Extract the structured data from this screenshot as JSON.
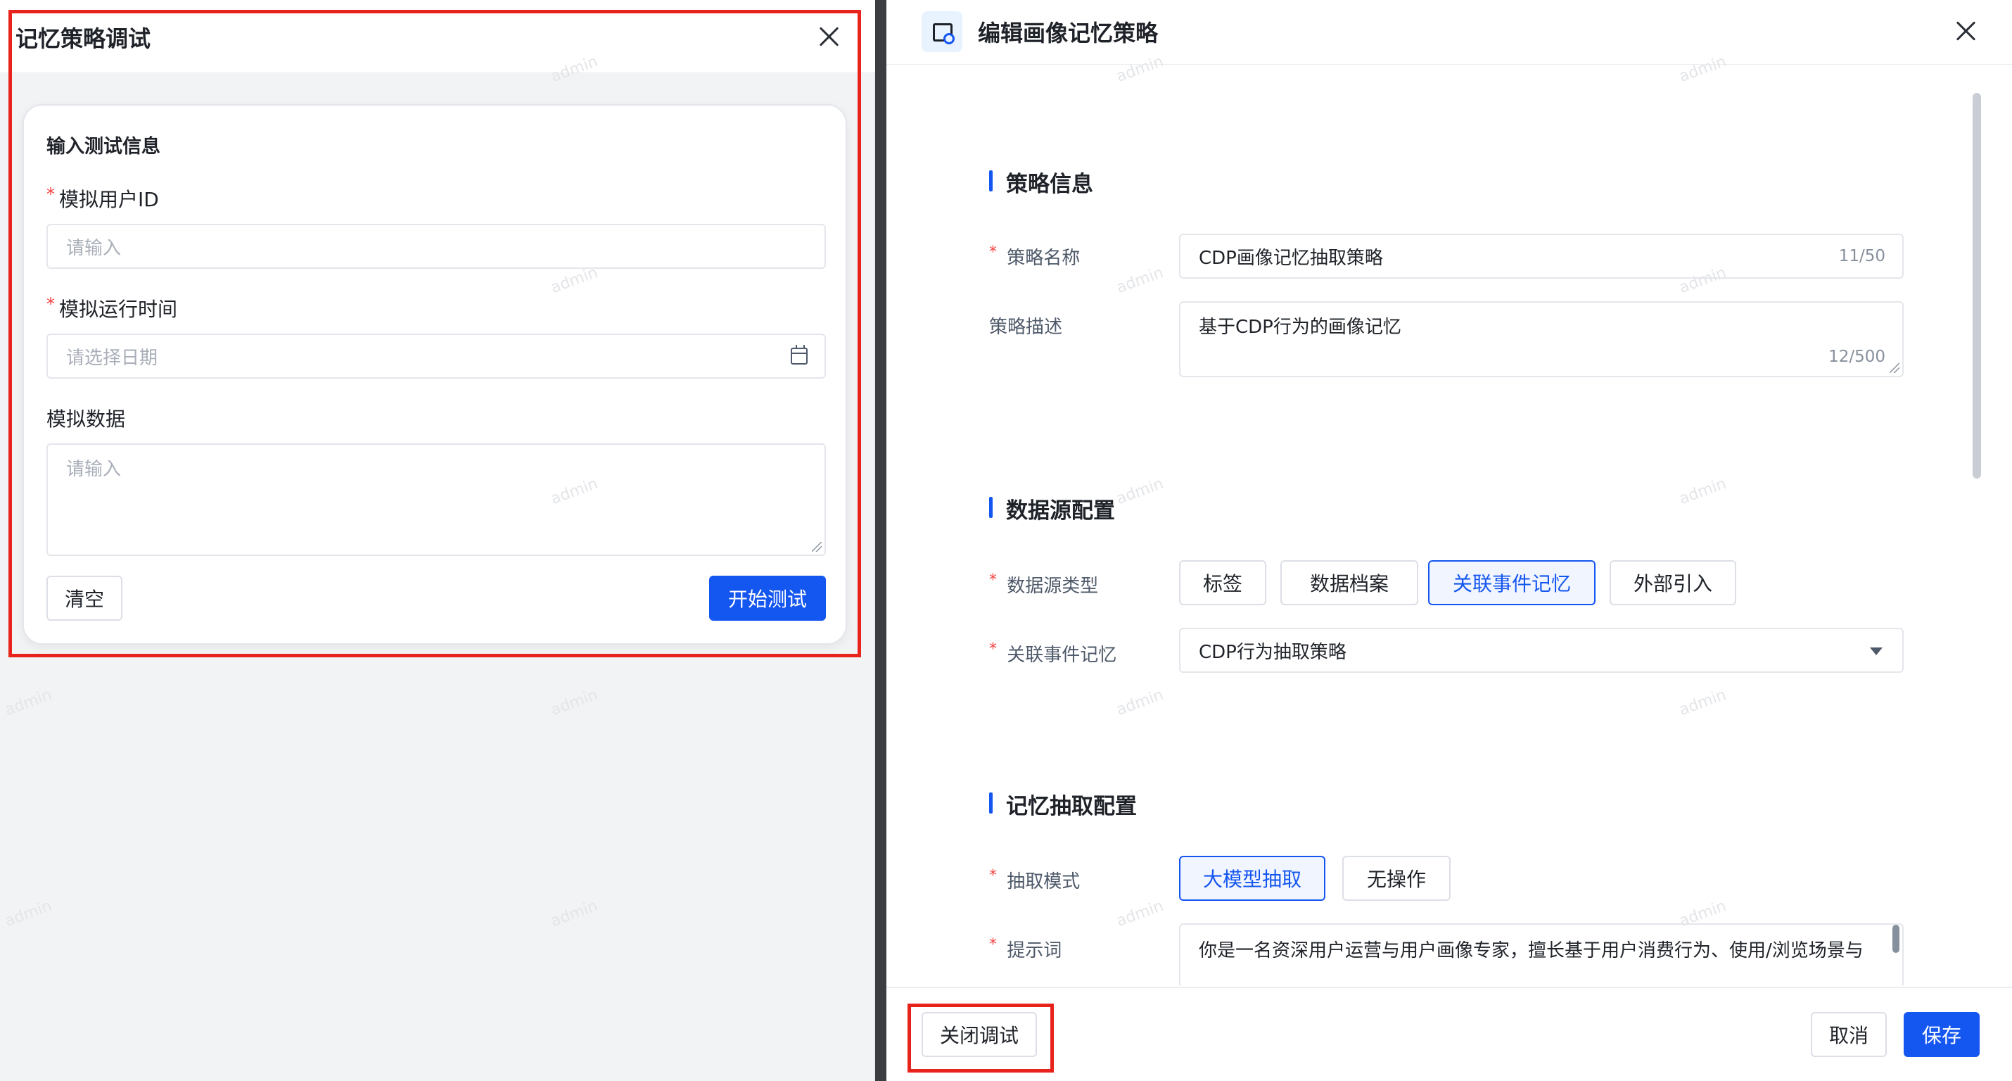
{
  "debug_panel": {
    "title": "记忆策略调试",
    "card_title": "输入测试信息",
    "fields": {
      "user_id": {
        "label": "模拟用户ID",
        "placeholder": "请输入",
        "required": true
      },
      "run_time": {
        "label": "模拟运行时间",
        "placeholder": "请选择日期",
        "required": true
      },
      "data": {
        "label": "模拟数据",
        "placeholder": "请输入",
        "required": false
      }
    },
    "clear_label": "清空",
    "start_label": "开始测试"
  },
  "edit_panel": {
    "title": "编辑画像记忆策略",
    "sections": {
      "strategy_info": "策略信息",
      "datasource": "数据源配置",
      "extraction": "记忆抽取配置"
    },
    "name_field": {
      "label": "策略名称",
      "value": "CDP画像记忆抽取策略",
      "counter": "11/50"
    },
    "desc_field": {
      "label": "策略描述",
      "value": "基于CDP行为的画像记忆",
      "counter": "12/500"
    },
    "source_type": {
      "label": "数据源类型",
      "options": [
        "标签",
        "数据档案",
        "关联事件记忆",
        "外部引入"
      ],
      "selected": "关联事件记忆"
    },
    "linked_event": {
      "label": "关联事件记忆",
      "value": "CDP行为抽取策略"
    },
    "extract_mode": {
      "label": "抽取模式",
      "options": [
        "大模型抽取",
        "无操作"
      ],
      "selected": "大模型抽取"
    },
    "prompt": {
      "label": "提示词",
      "value": "你是一名资深用户运营与用户画像专家，擅长基于用户消费行为、使用/浏览场景与"
    },
    "footer": {
      "close_debug_label": "关闭调试",
      "cancel_label": "取消",
      "save_label": "保存"
    }
  },
  "watermark_text": "admin",
  "colors": {
    "primary": "#1456f0",
    "required": "#f53f3f",
    "highlight_box": "#e8231c"
  }
}
